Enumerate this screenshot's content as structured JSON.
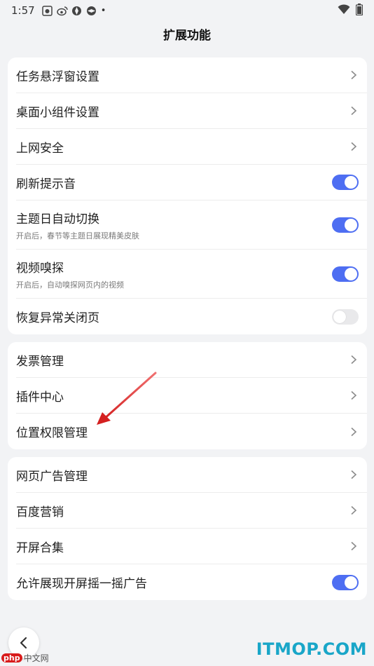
{
  "status_bar": {
    "time": "1:57",
    "dot": "•"
  },
  "header": {
    "title": "扩展功能"
  },
  "groups": [
    {
      "items": [
        {
          "label": "任务悬浮窗设置",
          "control": "chevron"
        },
        {
          "label": "桌面小组件设置",
          "control": "chevron"
        },
        {
          "label": "上网安全",
          "control": "chevron"
        },
        {
          "label": "刷新提示音",
          "control": "toggle",
          "toggle_on": true
        },
        {
          "label": "主题日自动切换",
          "sublabel": "开启后，春节等主题日展现精美皮肤",
          "control": "toggle",
          "toggle_on": true
        },
        {
          "label": "视频嗅探",
          "sublabel": "开启后，自动嗅探网页内的视频",
          "control": "toggle",
          "toggle_on": true
        },
        {
          "label": "恢复异常关闭页",
          "control": "toggle",
          "toggle_on": false
        }
      ]
    },
    {
      "items": [
        {
          "label": "发票管理",
          "control": "chevron"
        },
        {
          "label": "插件中心",
          "control": "chevron"
        },
        {
          "label": "位置权限管理",
          "control": "chevron"
        }
      ]
    },
    {
      "items": [
        {
          "label": "网页广告管理",
          "control": "chevron"
        },
        {
          "label": "百度营销",
          "control": "chevron"
        },
        {
          "label": "开屏合集",
          "control": "chevron"
        },
        {
          "label": "允许展现开屏摇一摇广告",
          "control": "toggle",
          "toggle_on": true
        }
      ]
    }
  ],
  "watermark": {
    "left_badge": "php",
    "left_text": "中文网",
    "right_text": "ITMOP.COM"
  },
  "colors": {
    "accent": "#4e6ef2",
    "background": "#f2f3f5",
    "annotation_arrow": "#d42020"
  },
  "icons": [
    "back-icon",
    "chevron-right-icon",
    "wifi-icon",
    "battery-icon"
  ]
}
